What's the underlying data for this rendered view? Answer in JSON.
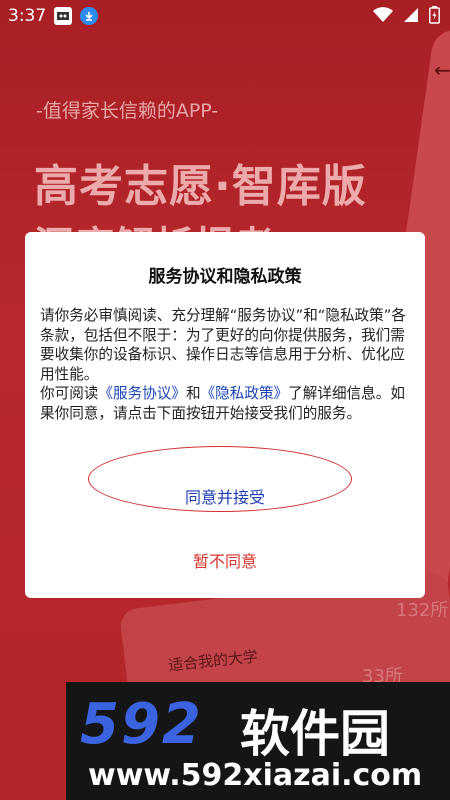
{
  "status_bar": {
    "time": "3:37"
  },
  "splash": {
    "tagline": "-值得家长信赖的APP-",
    "headline": "高考志愿·智库版",
    "headline2": "深度解析报考",
    "card_number_1": "132所",
    "card_number_2": "33所",
    "card_label": "适合我的大学"
  },
  "dialog": {
    "title": "服务协议和隐私政策",
    "body_part1": "请你务必审慎阅读、充分理解“服务协议”和“隐私政策”各条款，包括但不限于：为了更好的向你提供服务，我们需要收集你的设备标识、操作日志等信息用于分析、优化应用性能。",
    "body_part2_prefix": "你可阅读",
    "link_service": "《服务协议》",
    "and": "和",
    "link_privacy": "《隐私政策》",
    "body_part2_suffix": "了解详细信息。如果你同意，请点击下面按钮开始接受我们的服务。",
    "agree_label": "同意并接受",
    "disagree_label": "暂不同意"
  },
  "watermark": {
    "logo": "592",
    "name": "软件园",
    "url": "www.592xiazai.com"
  }
}
